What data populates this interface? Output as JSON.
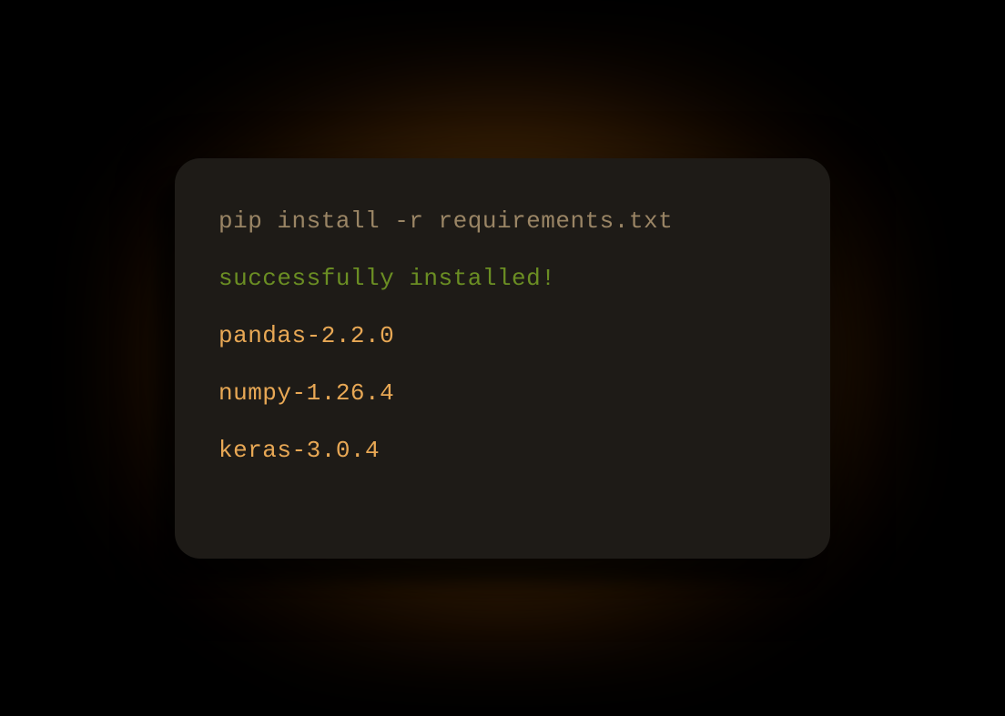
{
  "terminal": {
    "command": "pip install -r requirements.txt",
    "status": "successfully installed!",
    "packages": [
      "pandas-2.2.0",
      "numpy-1.26.4",
      "keras-3.0.4"
    ]
  }
}
